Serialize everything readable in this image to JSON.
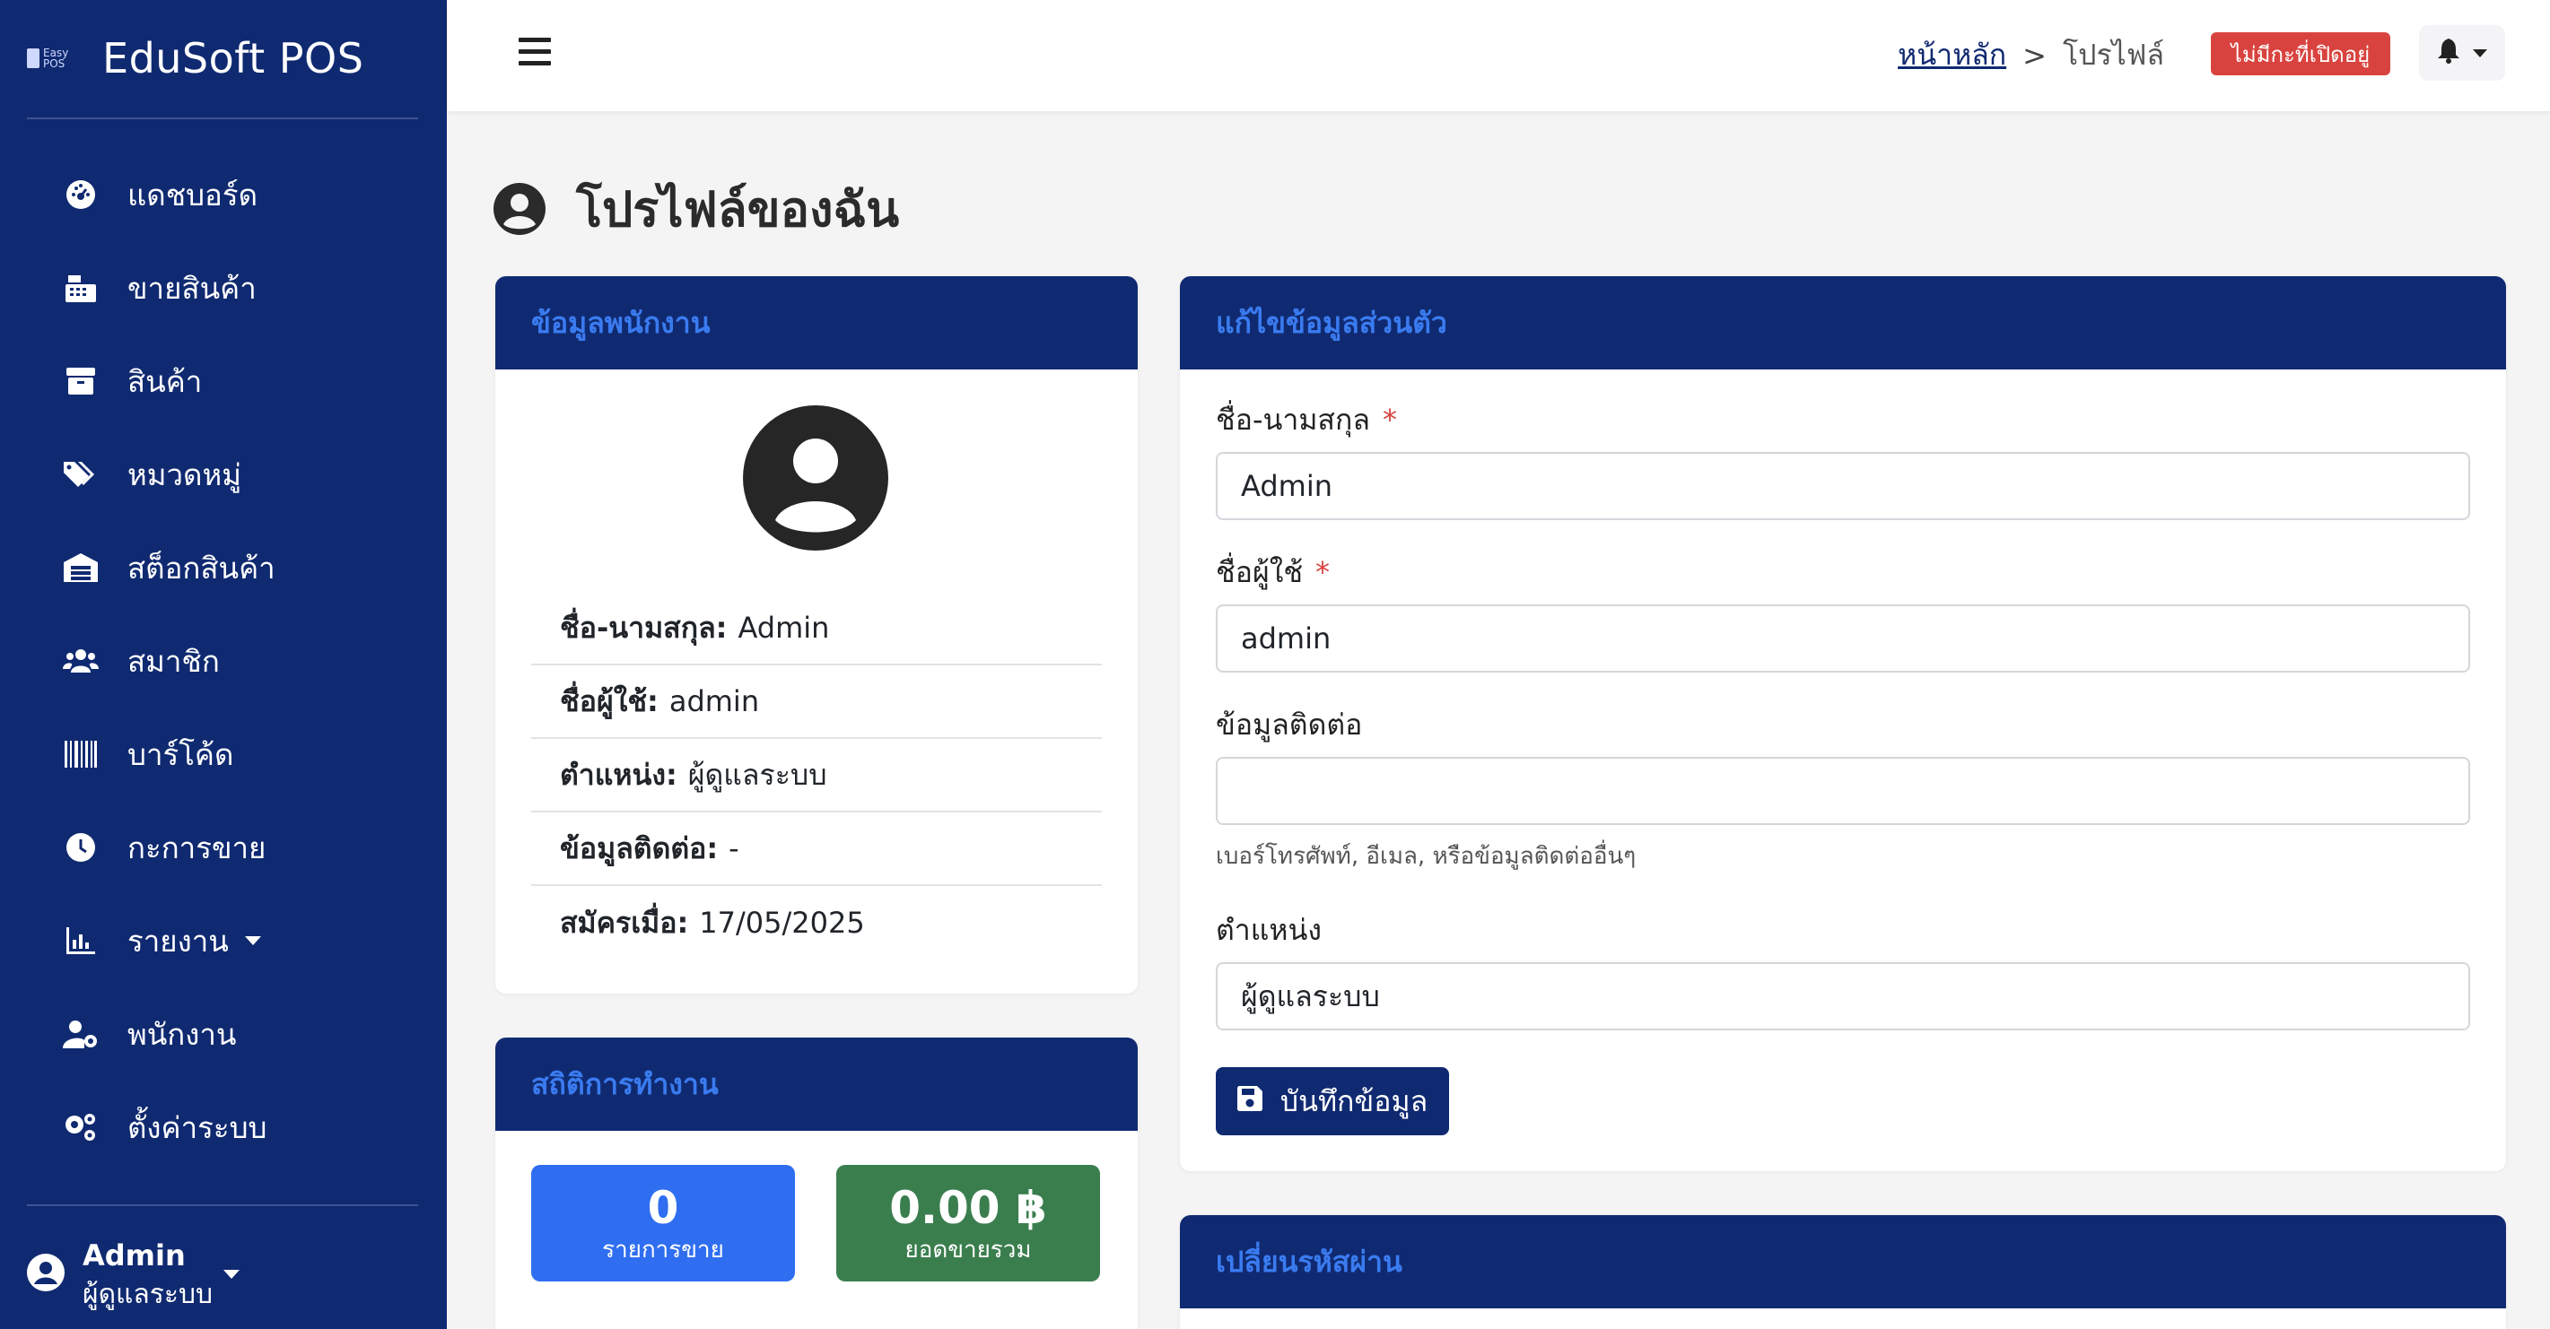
{
  "brand": {
    "name": "EduSoft POS",
    "logo_text_1": "Easy",
    "logo_text_2": "POS"
  },
  "sidebar": {
    "items": [
      {
        "label": "แดชบอร์ด",
        "icon": "dashboard-icon"
      },
      {
        "label": "ขายสินค้า",
        "icon": "cash-register-icon"
      },
      {
        "label": "สินค้า",
        "icon": "box-icon"
      },
      {
        "label": "หมวดหมู่",
        "icon": "tags-icon"
      },
      {
        "label": "สต็อกสินค้า",
        "icon": "warehouse-icon"
      },
      {
        "label": "สมาชิก",
        "icon": "users-icon"
      },
      {
        "label": "บาร์โค้ด",
        "icon": "barcode-icon"
      },
      {
        "label": "กะการขาย",
        "icon": "clock-icon"
      },
      {
        "label": "รายงาน",
        "icon": "chart-icon"
      },
      {
        "label": "พนักงาน",
        "icon": "user-gear-icon"
      },
      {
        "label": "ตั้งค่าระบบ",
        "icon": "gears-icon"
      }
    ],
    "user": {
      "name": "Admin",
      "role": "ผู้ดูแลระบบ"
    }
  },
  "topbar": {
    "breadcrumb_home": "หน้าหลัก",
    "breadcrumb_sep": ">",
    "breadcrumb_current": "โปรไฟล์",
    "shift_badge": "ไม่มีกะที่เปิดอยู่"
  },
  "page": {
    "title": "โปรไฟล์ของฉัน"
  },
  "info_card": {
    "title": "ข้อมูลพนักงาน",
    "rows": [
      {
        "label": "ชื่อ-นามสกุล:",
        "value": "Admin"
      },
      {
        "label": "ชื่อผู้ใช้:",
        "value": "admin"
      },
      {
        "label": "ตำแหน่ง:",
        "value": "ผู้ดูแลระบบ"
      },
      {
        "label": "ข้อมูลติดต่อ:",
        "value": "-"
      },
      {
        "label": "สมัครเมื่อ:",
        "value": "17/05/2025"
      }
    ]
  },
  "stats_card": {
    "title": "สถิติการทำงาน",
    "sales_count": "0",
    "sales_count_label": "รายการขาย",
    "sales_total": "0.00 ฿",
    "sales_total_label": "ยอดขายรวม"
  },
  "edit_card": {
    "title": "แก้ไขข้อมูลส่วนตัว",
    "fullname_label": "ชื่อ-นามสกุล",
    "fullname_value": "Admin",
    "username_label": "ชื่อผู้ใช้",
    "username_value": "admin",
    "contact_label": "ข้อมูลติดต่อ",
    "contact_value": "",
    "contact_help": "เบอร์โทรศัพท์, อีเมล, หรือข้อมูลติดต่ออื่นๆ",
    "position_label": "ตำแหน่ง",
    "position_value": "ผู้ดูแลระบบ",
    "required_mark": "*",
    "save_label": "บันทึกข้อมูล"
  },
  "password_card": {
    "title": "เปลี่ยนรหัสผ่าน"
  },
  "colors": {
    "sidebar": "#102a71",
    "card_header_text": "#3a7bf0",
    "badge_red": "#d9433f",
    "stat_blue": "#2f6ef0",
    "stat_green": "#3b7e4e"
  }
}
